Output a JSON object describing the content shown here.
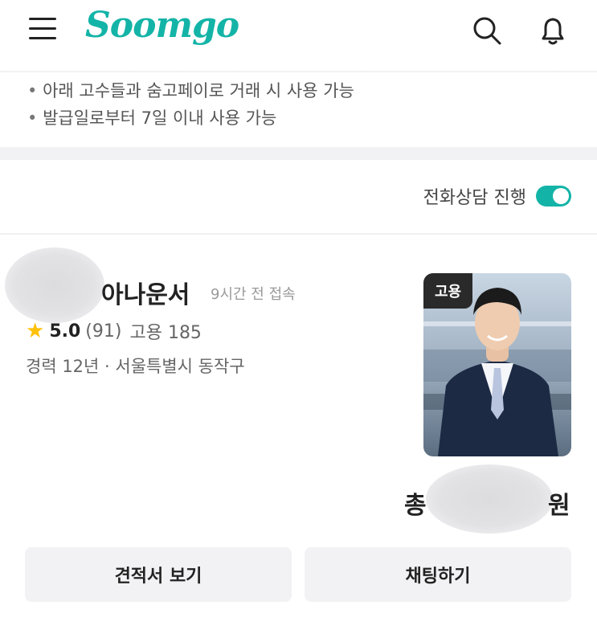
{
  "header": {
    "logo": "Soomgo",
    "icons": [
      "hamburger-menu-icon",
      "search-icon",
      "bell-icon"
    ]
  },
  "coupon_notes": [
    "아래 고수들과 숨고페이로 거래 시 사용 가능",
    "발급일로부터 7일 이내 사용 가능"
  ],
  "phone_consult": {
    "label": "전화상담 진행",
    "enabled": true
  },
  "pro": {
    "name_suffix": "아나운서",
    "last_seen": "9시간 전 접속",
    "rating": "5.0",
    "reviews": "(91)",
    "hires": "고용 185",
    "career": "경력 12년 · 서울특별시 동작구",
    "photo_badge": "고용",
    "price_prefix": "총",
    "price_suffix": "원"
  },
  "actions": {
    "quote_button": "견적서 보기",
    "chat_button": "채팅하기"
  },
  "colors": {
    "brand": "#13b4a7",
    "star": "#ffc107"
  }
}
